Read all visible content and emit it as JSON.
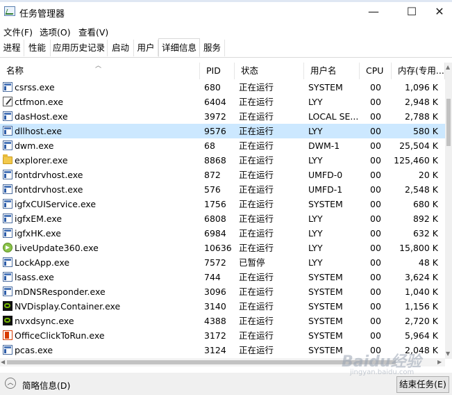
{
  "window": {
    "title": "任务管理器",
    "minimize": "—",
    "maximize": "☐",
    "close": "✕"
  },
  "menu": [
    "文件(F)",
    "选项(O)",
    "查看(V)"
  ],
  "tabs": [
    "进程",
    "性能",
    "应用历史记录",
    "启动",
    "用户",
    "详细信息",
    "服务"
  ],
  "active_tab": "详细信息",
  "columns": {
    "name": "名称",
    "pid": "PID",
    "status": "状态",
    "user": "用户名",
    "cpu": "CPU",
    "mem": "内存(专用..."
  },
  "processes": [
    {
      "name": "csrss.exe",
      "pid": "680",
      "status": "正在运行",
      "user": "SYSTEM",
      "cpu": "00",
      "mem": "1,096 K",
      "icon": "exe-icon"
    },
    {
      "name": "ctfmon.exe",
      "pid": "6404",
      "status": "正在运行",
      "user": "LYY",
      "cpu": "00",
      "mem": "2,948 K",
      "icon": "pen-icon"
    },
    {
      "name": "dasHost.exe",
      "pid": "3972",
      "status": "正在运行",
      "user": "LOCAL SE...",
      "cpu": "00",
      "mem": "2,788 K",
      "icon": "exe-icon"
    },
    {
      "name": "dllhost.exe",
      "pid": "9576",
      "status": "正在运行",
      "user": "LYY",
      "cpu": "00",
      "mem": "580 K",
      "icon": "exe-icon",
      "selected": true
    },
    {
      "name": "dwm.exe",
      "pid": "68",
      "status": "正在运行",
      "user": "DWM-1",
      "cpu": "00",
      "mem": "25,504 K",
      "icon": "exe-icon"
    },
    {
      "name": "explorer.exe",
      "pid": "8868",
      "status": "正在运行",
      "user": "LYY",
      "cpu": "00",
      "mem": "125,460 K",
      "icon": "folder-icon"
    },
    {
      "name": "fontdrvhost.exe",
      "pid": "872",
      "status": "正在运行",
      "user": "UMFD-0",
      "cpu": "00",
      "mem": "20 K",
      "icon": "exe-icon"
    },
    {
      "name": "fontdrvhost.exe",
      "pid": "576",
      "status": "正在运行",
      "user": "UMFD-1",
      "cpu": "00",
      "mem": "2,548 K",
      "icon": "exe-icon"
    },
    {
      "name": "igfxCUIService.exe",
      "pid": "1756",
      "status": "正在运行",
      "user": "SYSTEM",
      "cpu": "00",
      "mem": "680 K",
      "icon": "exe-icon"
    },
    {
      "name": "igfxEM.exe",
      "pid": "6808",
      "status": "正在运行",
      "user": "LYY",
      "cpu": "00",
      "mem": "892 K",
      "icon": "exe-icon"
    },
    {
      "name": "igfxHK.exe",
      "pid": "6984",
      "status": "正在运行",
      "user": "LYY",
      "cpu": "00",
      "mem": "632 K",
      "icon": "exe-icon"
    },
    {
      "name": "LiveUpdate360.exe",
      "pid": "10636",
      "status": "正在运行",
      "user": "LYY",
      "cpu": "00",
      "mem": "15,800 K",
      "icon": "green-update-icon"
    },
    {
      "name": "LockApp.exe",
      "pid": "7572",
      "status": "已暂停",
      "user": "LYY",
      "cpu": "00",
      "mem": "48 K",
      "icon": "exe-icon"
    },
    {
      "name": "lsass.exe",
      "pid": "744",
      "status": "正在运行",
      "user": "SYSTEM",
      "cpu": "00",
      "mem": "3,624 K",
      "icon": "exe-icon"
    },
    {
      "name": "mDNSResponder.exe",
      "pid": "3096",
      "status": "正在运行",
      "user": "SYSTEM",
      "cpu": "00",
      "mem": "1,040 K",
      "icon": "exe-icon"
    },
    {
      "name": "NVDisplay.Container.exe",
      "pid": "3140",
      "status": "正在运行",
      "user": "SYSTEM",
      "cpu": "00",
      "mem": "1,156 K",
      "icon": "nvidia-icon"
    },
    {
      "name": "nvxdsync.exe",
      "pid": "4388",
      "status": "正在运行",
      "user": "SYSTEM",
      "cpu": "00",
      "mem": "2,720 K",
      "icon": "nvidia-icon"
    },
    {
      "name": "OfficeClickToRun.exe",
      "pid": "3172",
      "status": "正在运行",
      "user": "SYSTEM",
      "cpu": "00",
      "mem": "5,964 K",
      "icon": "office-icon"
    },
    {
      "name": "pcas.exe",
      "pid": "3124",
      "status": "正在运行",
      "user": "SYSTEM",
      "cpu": "00",
      "mem": "2,048 K",
      "icon": "exe-icon"
    }
  ],
  "footer": {
    "brief_label": "简略信息(D)",
    "end_task_label": "结束任务(E)"
  },
  "watermark": {
    "main": "Baidu经验",
    "sub": "jingyan.baidu.com"
  },
  "colors": {
    "selected_row": "#cce8ff",
    "footer_bg": "#f0f0f0"
  }
}
